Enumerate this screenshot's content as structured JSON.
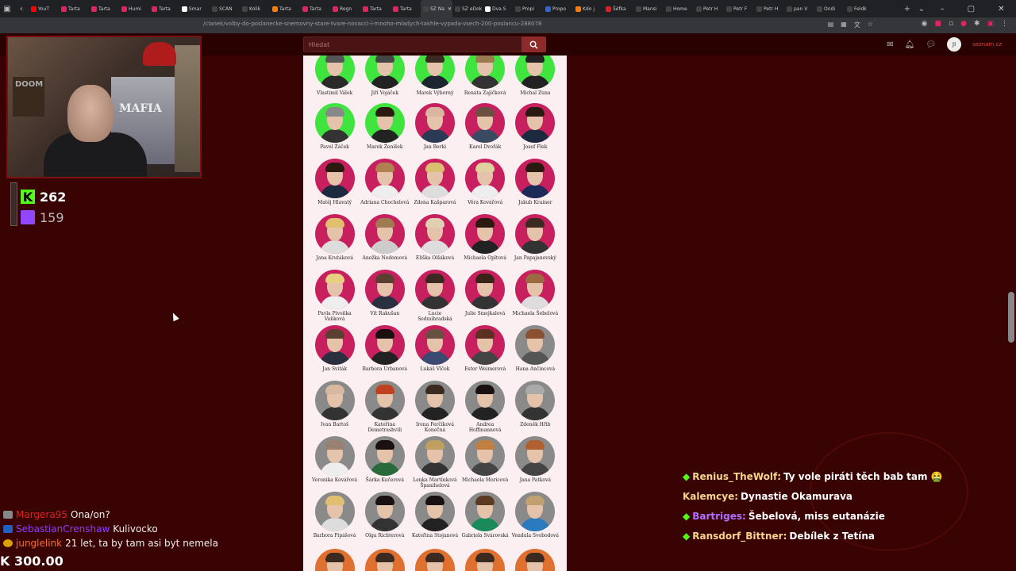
{
  "browser": {
    "tabs": [
      {
        "label": "YouT",
        "color": "#ff0000"
      },
      {
        "label": "Tarta",
        "color": "#e0245e"
      },
      {
        "label": "Tarta",
        "color": "#e0245e"
      },
      {
        "label": "Humi",
        "color": "#e0245e"
      },
      {
        "label": "Tarta",
        "color": "#e0245e"
      },
      {
        "label": "Smar",
        "color": "#ffffff"
      },
      {
        "label": "SCAN",
        "color": "#444444"
      },
      {
        "label": "Kolik",
        "color": "#444444"
      },
      {
        "label": "Tarta",
        "color": "#ff7a00"
      },
      {
        "label": "Tarta",
        "color": "#e0245e"
      },
      {
        "label": "Regn",
        "color": "#e0245e"
      },
      {
        "label": "Tarta",
        "color": "#e0245e"
      },
      {
        "label": "Tarta",
        "color": "#e0245e"
      },
      {
        "label": "SZ Na",
        "color": "#444444",
        "active": true
      },
      {
        "label": "SZ eDok",
        "color": "#444444"
      },
      {
        "label": "Dva S",
        "color": "#ffffff"
      },
      {
        "label": "Propi",
        "color": "#444444"
      },
      {
        "label": "Propo",
        "color": "#3366cc"
      },
      {
        "label": "Kdo j",
        "color": "#ff7a00"
      },
      {
        "label": "Šéfka",
        "color": "#e02020"
      },
      {
        "label": "Mansi",
        "color": "#444444"
      },
      {
        "label": "Home",
        "color": "#444444"
      },
      {
        "label": "Petr H",
        "color": "#444444"
      },
      {
        "label": "Petr F",
        "color": "#444444"
      },
      {
        "label": "Petr H",
        "color": "#444444"
      },
      {
        "label": "pan V",
        "color": "#444444"
      },
      {
        "label": "Ondi",
        "color": "#444444"
      },
      {
        "label": "Feldk",
        "color": "#444444"
      }
    ],
    "url": "/clanek/volby-do-poslanecke-snemovny-stare-tvare-novacci-i-mnoho-mladych-takhle-vypada-vsech-200-poslancu-288078",
    "search_placeholder": "Hledat",
    "avatar_initials": "JI",
    "brand": "seznam.cz"
  },
  "stream": {
    "kick_viewers": "262",
    "twitch_viewers": "159",
    "webcam_label": "MAFIA",
    "kick_money": "K 300.00"
  },
  "left_chat": [
    {
      "user": "Margera95",
      "color": "#e02020",
      "text": "Ona/on?"
    },
    {
      "user": "SebastianCrenshaw",
      "color": "#8a3cff",
      "text": "Kulivocko"
    },
    {
      "user": "junglelink",
      "color": "#ff6a2a",
      "text": "21 let, ta by tam asi byt nemela"
    }
  ],
  "right_chat": [
    {
      "user": "Renius_TheWolf:",
      "color": "#f6d58a",
      "text": "Ty vole piráti těch bab tam 🤮",
      "badge": true
    },
    {
      "user": "Kalemcye:",
      "color": "#f6d58a",
      "text": "Dynastie Okamurava",
      "badge": false
    },
    {
      "user": "Bartriges:",
      "color": "#b070ff",
      "text": "Šebelová, miss eutanázie",
      "badge": true
    },
    {
      "user": "Ransdorf_Bittner:",
      "color": "#f6d58a",
      "text": "Debílek z Tetína",
      "badge": true
    }
  ],
  "article_rows": [
    [
      {
        "name": "Vlastimil Válek",
        "bg": "#3fe43f",
        "hair": "#555",
        "suit": "#2a2a2a"
      },
      {
        "name": "Jiří Vojáček",
        "bg": "#3fe43f",
        "hair": "#444",
        "suit": "#222"
      },
      {
        "name": "Marek Výborný",
        "bg": "#3fe43f",
        "hair": "#3a2a20",
        "suit": "#1e2430"
      },
      {
        "name": "Renáta Zajíčková",
        "bg": "#3fe43f",
        "hair": "#9a7b50",
        "suit": "#333"
      },
      {
        "name": "Michal Zuna",
        "bg": "#3fe43f",
        "hair": "#222",
        "suit": "#222"
      }
    ],
    [
      {
        "name": "Pavel Žáček",
        "bg": "#3fe43f",
        "hair": "#888",
        "suit": "#333"
      },
      {
        "name": "Marek Ženíšek",
        "bg": "#3fe43f",
        "hair": "#2a1a10",
        "suit": "#222"
      },
      {
        "name": "Jan Berki",
        "bg": "#c8205f",
        "hair": "#dab5a0",
        "suit": "#2a3a55"
      },
      {
        "name": "Karel Dvořák",
        "bg": "#c8205f",
        "hair": "#6a5040",
        "suit": "#3a4a60"
      },
      {
        "name": "Josef Flek",
        "bg": "#c8205f",
        "hair": "#2a1a10",
        "suit": "#1c2a40"
      }
    ],
    [
      {
        "name": "Matěj Hlavatý",
        "bg": "#c8205f",
        "hair": "#2a1a10",
        "suit": "#1c2a40"
      },
      {
        "name": "Adriana Chochelová",
        "bg": "#c8205f",
        "hair": "#b08050",
        "suit": "#eee"
      },
      {
        "name": "Zdena Kašparová",
        "bg": "#c8205f",
        "hair": "#d8c070",
        "suit": "#ddd"
      },
      {
        "name": "Věra Kovářová",
        "bg": "#c8205f",
        "hair": "#e0d0a0",
        "suit": "#eee"
      },
      {
        "name": "Jakub Krainer",
        "bg": "#c8205f",
        "hair": "#2a1a10",
        "suit": "#1c2a5a"
      }
    ],
    [
      {
        "name": "Jana Krutáková",
        "bg": "#c8205f",
        "hair": "#e0c070",
        "suit": "#ddd"
      },
      {
        "name": "Anežka Nedomová",
        "bg": "#c8205f",
        "hair": "#a07a50",
        "suit": "#ccc"
      },
      {
        "name": "Eliška Olšáková",
        "bg": "#c8205f",
        "hair": "#e0d0b0",
        "suit": "#ddd"
      },
      {
        "name": "Michaela Opltová",
        "bg": "#c8205f",
        "hair": "#2a1a10",
        "suit": "#222"
      },
      {
        "name": "Jan Papajanovský",
        "bg": "#c8205f",
        "hair": "#3a2a20",
        "suit": "#333"
      }
    ],
    [
      {
        "name": "Pavla Pivoňka Vaňková",
        "bg": "#c8205f",
        "hair": "#e8d080",
        "suit": "#eee"
      },
      {
        "name": "Vít Rakušan",
        "bg": "#c8205f",
        "hair": "#5a4030",
        "suit": "#2a3040"
      },
      {
        "name": "Lucie Sedmihradská",
        "bg": "#c8205f",
        "hair": "#3a2a20",
        "suit": "#333"
      },
      {
        "name": "Julie Smejkalová",
        "bg": "#c8205f",
        "hair": "#3a2418",
        "suit": "#333"
      },
      {
        "name": "Michaela Šebelová",
        "bg": "#c8205f",
        "hair": "#9a6a40",
        "suit": "#ddd"
      }
    ],
    [
      {
        "name": "Jan Sviták",
        "bg": "#c8205f",
        "hair": "#5a4030",
        "suit": "#2a3040"
      },
      {
        "name": "Barbora Urbanová",
        "bg": "#c8205f",
        "hair": "#1a1010",
        "suit": "#222"
      },
      {
        "name": "Lukáš Vlček",
        "bg": "#c8205f",
        "hair": "#6a5040",
        "suit": "#3a4a70"
      },
      {
        "name": "Ester Weimerová",
        "bg": "#c8205f",
        "hair": "#5a3020",
        "suit": "#444"
      },
      {
        "name": "Hana Ančincová",
        "bg": "#8a8a8a",
        "hair": "#8a5030",
        "suit": "#555"
      }
    ],
    [
      {
        "name": "Ivan Bartoš",
        "bg": "#8a8a8a",
        "hair": "#d8b8a0",
        "suit": "#333"
      },
      {
        "name": "Kateřina Demetrashvili",
        "bg": "#8a8a8a",
        "hair": "#c04020",
        "suit": "#333"
      },
      {
        "name": "Irena Ferčíková Konečná",
        "bg": "#8a8a8a",
        "hair": "#3a2a20",
        "suit": "#222"
      },
      {
        "name": "Andrea Hoffmannová",
        "bg": "#8a8a8a",
        "hair": "#1a1010",
        "suit": "#222"
      },
      {
        "name": "Zdeněk Hřib",
        "bg": "#8a8a8a",
        "hair": "#aaa",
        "suit": "#333"
      }
    ],
    [
      {
        "name": "Veronika Kovářová",
        "bg": "#8a8a8a",
        "hair": "#9a8070",
        "suit": "#eee"
      },
      {
        "name": "Šárka Kučerová",
        "bg": "#8a8a8a",
        "hair": "#1a1010",
        "suit": "#2a6a3a"
      },
      {
        "name": "Lenka Martínková Španihelová",
        "bg": "#8a8a8a",
        "hair": "#c0a060",
        "suit": "#333"
      },
      {
        "name": "Michaela Moricová",
        "bg": "#8a8a8a",
        "hair": "#c08040",
        "suit": "#444"
      },
      {
        "name": "Jana Patková",
        "bg": "#8a8a8a",
        "hair": "#b06030",
        "suit": "#444"
      }
    ],
    [
      {
        "name": "Barbora Pipášová",
        "bg": "#8a8a8a",
        "hair": "#e0c070",
        "suit": "#ddd"
      },
      {
        "name": "Olga Richterová",
        "bg": "#8a8a8a",
        "hair": "#1a1010",
        "suit": "#333"
      },
      {
        "name": "Kateřina Stojanová",
        "bg": "#8a8a8a",
        "hair": "#1a1010",
        "suit": "#222"
      },
      {
        "name": "Gabriela Svárovská",
        "bg": "#8a8a8a",
        "hair": "#5a3a20",
        "suit": "#1a8a5a"
      },
      {
        "name": "Vendula Svobodová",
        "bg": "#8a8a8a",
        "hair": "#c0a070",
        "suit": "#2a7ac0"
      }
    ],
    [
      {
        "name": "",
        "bg": "#e07030",
        "hair": "#3a2a20",
        "suit": "#222"
      },
      {
        "name": "",
        "bg": "#e07030",
        "hair": "#3a2a20",
        "suit": "#222"
      },
      {
        "name": "",
        "bg": "#e07030",
        "hair": "#3a2a20",
        "suit": "#222"
      },
      {
        "name": "",
        "bg": "#e07030",
        "hair": "#3a2a20",
        "suit": "#222"
      },
      {
        "name": "",
        "bg": "#e07030",
        "hair": "#3a2a20",
        "suit": "#222"
      }
    ]
  ]
}
